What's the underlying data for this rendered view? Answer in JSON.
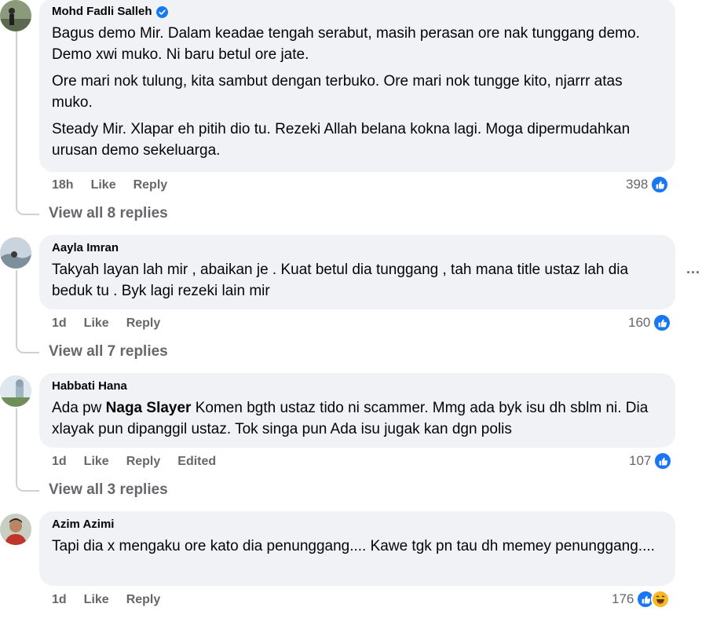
{
  "comments": [
    {
      "author": "Mohd Fadli Salleh",
      "verified": true,
      "paragraphs": [
        "Bagus demo Mir. Dalam keadae tengah serabut, masih perasan ore nak tunggang demo. Demo xwi muko. Ni baru betul ore jate.",
        "Ore mari nok tulung, kita sambut dengan terbuko. Ore mari nok tungge kito, njarrr atas muko.",
        "Steady Mir. Xlapar eh pitih dio tu. Rezeki Allah belana kokna lagi. Moga dipermudahkan urusan demo sekeluarga."
      ],
      "time": "18h",
      "like": "Like",
      "reply": "Reply",
      "reaction_count": "398",
      "view_replies": "View all 8 replies"
    },
    {
      "author": "Aayla Imran",
      "text": "Takyah layan lah mir , abaikan je . Kuat betul dia tunggang , tah mana title ustaz lah dia beduk tu . Byk lagi rezeki lain mir",
      "time": "1d",
      "like": "Like",
      "reply": "Reply",
      "reaction_count": "160",
      "view_replies": "View all 7 replies"
    },
    {
      "author": "Habbati Hana",
      "text_before": "Ada pw ",
      "mention": "Naga Slayer",
      "text_after": " Komen bgth ustaz tido ni scammer. Mmg ada byk isu dh sblm ni. Dia xlayak pun dipanggil ustaz. Tok singa pun Ada isu jugak kan dgn polis",
      "time": "1d",
      "like": "Like",
      "reply": "Reply",
      "edited": "Edited",
      "reaction_count": "107",
      "view_replies": "View all 3 replies"
    },
    {
      "author": "Azim Azimi",
      "text": "Tapi dia x mengaku ore kato dia penunggang.... Kawe tgk pn tau dh memey penunggang....",
      "time": "1d",
      "like": "Like",
      "reply": "Reply",
      "reaction_count": "176"
    }
  ],
  "more_options": "...",
  "colors": {
    "bubble": "#f0f2f5",
    "meta_text": "#65676b",
    "like_blue": "#1877f2",
    "haha_yellow": "#f7b928",
    "thread_line": "#ced0d4"
  },
  "icons": [
    "verified-badge-icon",
    "like-reaction-icon",
    "haha-reaction-icon",
    "more-options-icon"
  ]
}
